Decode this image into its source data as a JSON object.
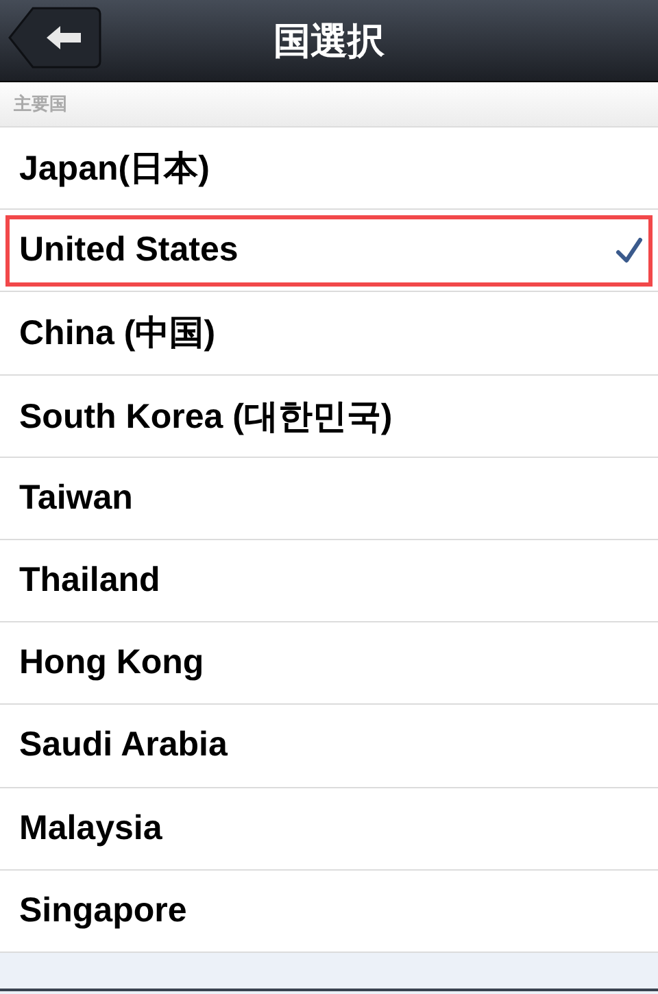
{
  "nav_bar": {
    "title": "国選択"
  },
  "section": {
    "header": "主要国"
  },
  "countries": [
    {
      "name": "Japan(日本)",
      "selected": false,
      "outlined": false
    },
    {
      "name": "United States",
      "selected": true,
      "outlined": true
    },
    {
      "name": "China (中国)",
      "selected": false,
      "outlined": false
    },
    {
      "name": "South Korea (대한민국)",
      "selected": false,
      "outlined": false
    },
    {
      "name": "Taiwan",
      "selected": false,
      "outlined": false
    },
    {
      "name": "Thailand",
      "selected": false,
      "outlined": false
    },
    {
      "name": "Hong Kong",
      "selected": false,
      "outlined": false
    },
    {
      "name": "Saudi Arabia",
      "selected": false,
      "outlined": false
    },
    {
      "name": "Malaysia",
      "selected": false,
      "outlined": false
    },
    {
      "name": "Singapore",
      "selected": false,
      "outlined": false
    }
  ]
}
